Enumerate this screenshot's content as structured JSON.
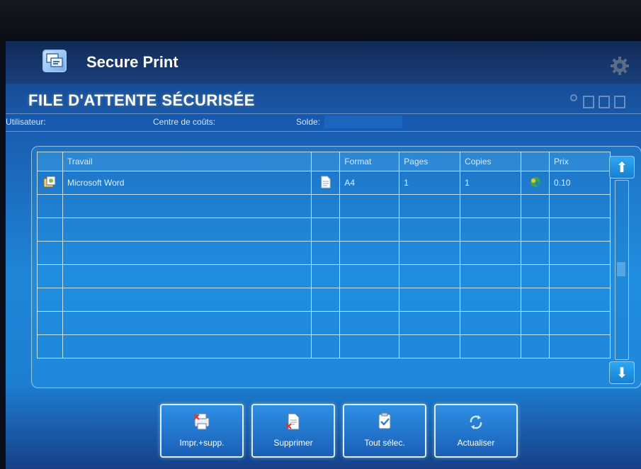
{
  "app": {
    "title": "Secure Print"
  },
  "queue": {
    "title": "FILE D'ATTENTE SÉCURISÉE"
  },
  "info": {
    "user_label": "Utilisateur:",
    "cost_center_label": "Centre de coûts:",
    "balance_label": "Solde:"
  },
  "table": {
    "columns": [
      "Travail",
      "Format",
      "Pages",
      "Copies",
      "Prix"
    ],
    "rows": [
      {
        "job": "Microsoft Word",
        "format": "A4",
        "pages": "1",
        "copies": "1",
        "price": "0.10"
      }
    ]
  },
  "buttons": {
    "print_delete": "Impr.+supp.",
    "delete": "Supprimer",
    "select_all": "Tout sélec.",
    "refresh": "Actualiser"
  },
  "icons": {
    "app": "secure-print-icon",
    "settings": "gear-icon",
    "scroll_up": "arrow-up-icon",
    "scroll_down": "arrow-down-icon"
  },
  "colors": {
    "accent": "#1f86d8",
    "header_bar": "#112a56"
  }
}
